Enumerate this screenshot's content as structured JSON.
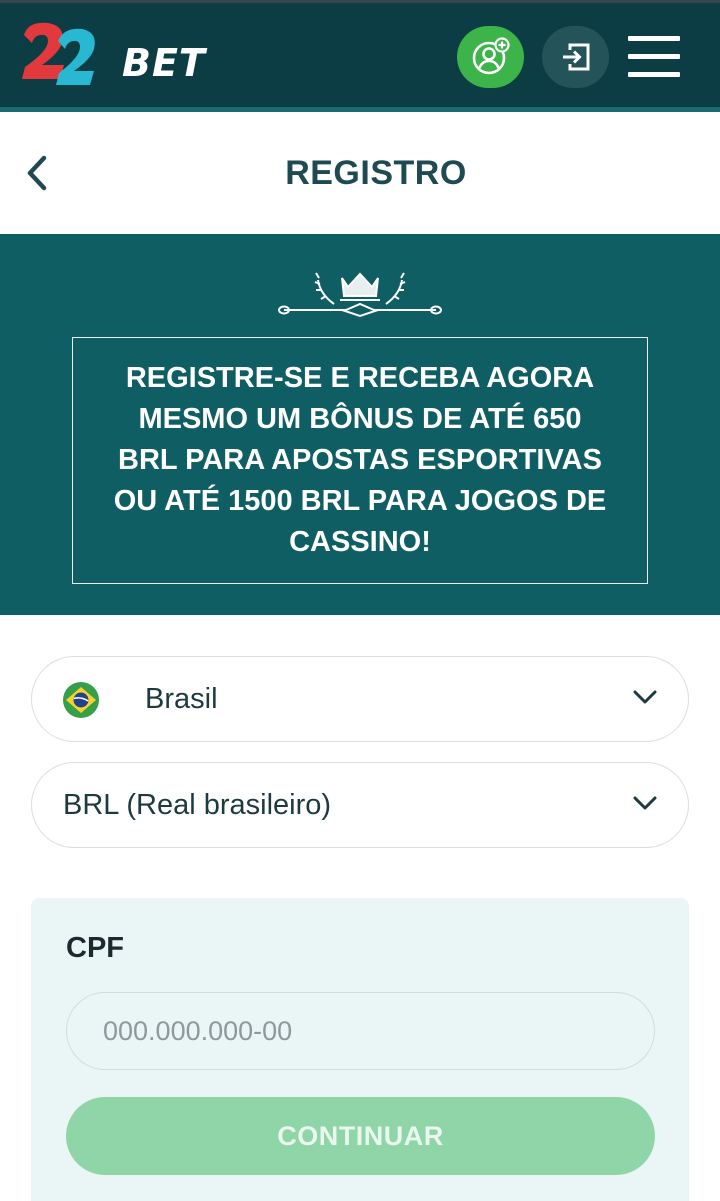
{
  "header": {
    "logo_text": "BET",
    "logo_digits": "22",
    "register_icon": "add-user-icon",
    "login_icon": "login-icon",
    "menu_icon": "hamburger-menu-icon"
  },
  "page": {
    "title": "REGISTRO",
    "back_icon": "chevron-left-icon"
  },
  "banner": {
    "emblem_icon": "crown-laurel-icon",
    "promo": "REGISTRE-SE E RECEBA AGORA MESMO UM BÔNUS DE ATÉ 650 BRL PARA APOSTAS ESPORTIVAS OU ATÉ 1500 BRL PARA JOGOS DE CASSINO!"
  },
  "form": {
    "country": {
      "value": "Brasil",
      "flag_icon": "brazil-flag-icon"
    },
    "currency": {
      "value": "BRL (Real brasileiro)"
    },
    "cpf": {
      "label": "CPF",
      "placeholder": "000.000.000-00",
      "value": ""
    },
    "continue_label": "CONTINUAR"
  },
  "colors": {
    "topbar": "#0d3d44",
    "banner": "#0e5e63",
    "register_green": "#3cb449",
    "continue_disabled": "#8fd5a8",
    "title_text": "#1f4a52",
    "panel_bg": "#eaf5f5"
  }
}
